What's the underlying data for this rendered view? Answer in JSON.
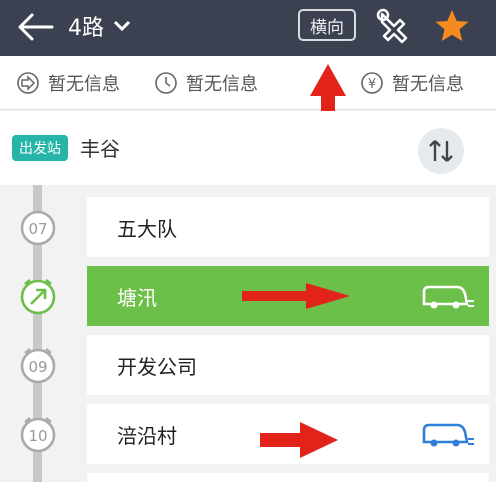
{
  "header": {
    "route": "4路",
    "landscape_label": "横向",
    "bg": "#3b4150"
  },
  "info": {
    "first_last": "暂无信息",
    "interval": "暂无信息",
    "fare": "暂无信息",
    "fare_symbol": "¥"
  },
  "station": {
    "tag": "出发站",
    "name": "丰谷"
  },
  "stops": [
    {
      "no": "07",
      "name": "五大队"
    },
    {
      "no": "",
      "name": "塘汛",
      "current": true,
      "has_bus": true
    },
    {
      "no": "09",
      "name": "开发公司"
    },
    {
      "no": "10",
      "name": "涪沿村",
      "has_bus": true
    }
  ],
  "colors": {
    "current": "#6cbf49",
    "accent": "#26b5a8",
    "bus_blue": "#2f7fd8",
    "star": "#f58a1f",
    "arrow": "#e2231a"
  }
}
